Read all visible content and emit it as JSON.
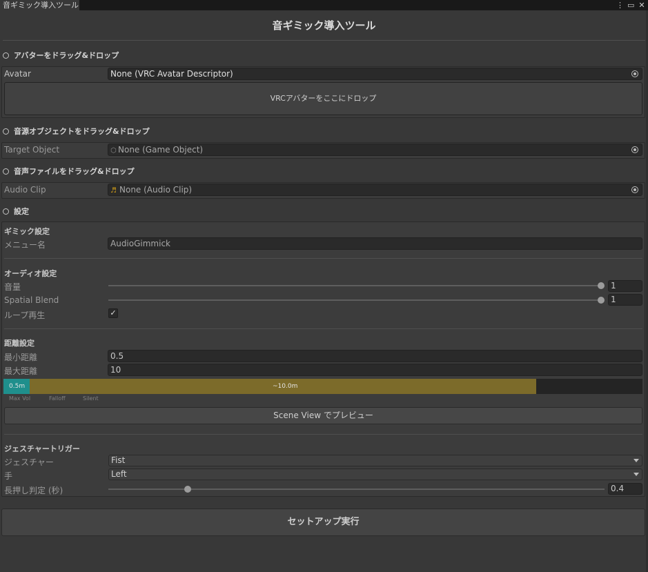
{
  "window": {
    "tab_title": "音ギミック導入ツール",
    "page_title": "音ギミック導入ツール"
  },
  "sections": {
    "avatar_header": "アバターをドラッグ&ドロップ",
    "source_header": "音源オブジェクトをドラッグ&ドロップ",
    "audio_header": "音声ファイルをドラッグ&ドロップ",
    "settings_header": "設定"
  },
  "avatar": {
    "label": "Avatar",
    "value": "None (VRC Avatar Descriptor)",
    "drop_hint": "VRCアバターをここにドロップ"
  },
  "target": {
    "label": "Target Object",
    "value": "None (Game Object)"
  },
  "audio": {
    "label": "Audio Clip",
    "value": "None (Audio Clip)",
    "icon_glyph": "♬"
  },
  "gimmick": {
    "heading": "ギミック設定",
    "menu_label": "メニュー名",
    "menu_value": "AudioGimmick"
  },
  "audio_settings": {
    "heading": "オーディオ設定",
    "volume_label": "音量",
    "volume_value": "1",
    "volume_level": 1.0,
    "spatial_label": "Spatial Blend",
    "spatial_value": "1",
    "spatial_level": 1.0,
    "loop_label": "ループ再生",
    "loop_checked": "✓"
  },
  "distance": {
    "heading": "距離設定",
    "min_label": "最小距離",
    "min_value": "0.5",
    "max_label": "最大距離",
    "max_value": "10",
    "bar_min_text": "0.5m",
    "bar_max_text": "~10.0m",
    "legend": [
      "Max Vol",
      "Falloff",
      "Silent"
    ],
    "preview_button": "Scene View でプレビュー"
  },
  "gesture": {
    "heading": "ジェスチャートリガー",
    "gesture_label": "ジェスチャー",
    "gesture_value": "Fist",
    "hand_label": "手",
    "hand_value": "Left",
    "hold_label": "長押し判定 (秒)",
    "hold_value": "0.4",
    "hold_level": 0.16
  },
  "actions": {
    "setup_button": "セットアップ実行"
  },
  "colors": {
    "min_range": "#1f8f8c",
    "falloff_range": "#7c6b2a"
  }
}
